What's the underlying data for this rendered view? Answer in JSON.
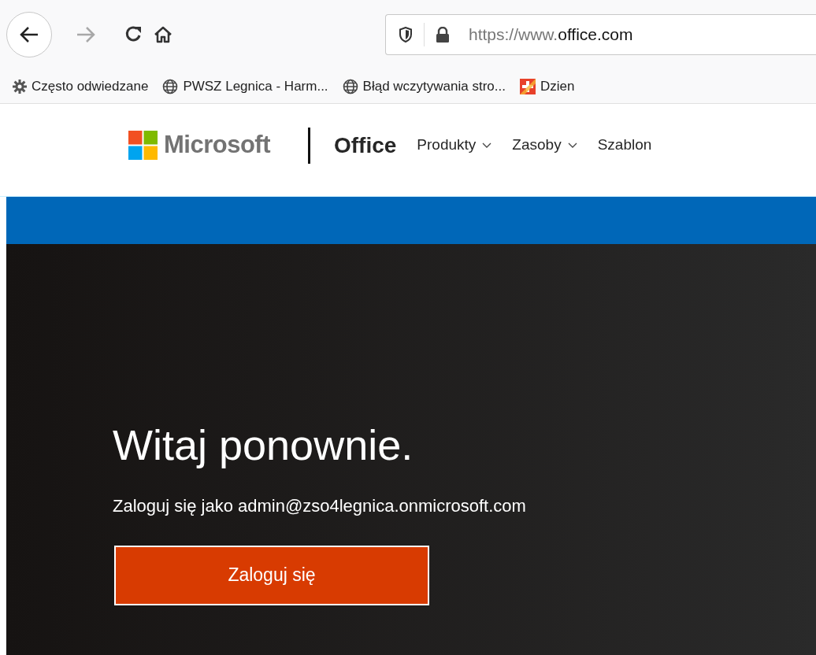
{
  "browser": {
    "url": "https://www.**office.com**"
  },
  "bookmarks": [
    {
      "kind": "folder",
      "label": "Często odwiedzane"
    },
    {
      "kind": "globe",
      "label": "PWSZ Legnica - Harm..."
    },
    {
      "kind": "globe",
      "label": "Błąd wczytywania stro..."
    },
    {
      "kind": "site",
      "label": "Dzien"
    }
  ],
  "header": {
    "brand": "Microsoft",
    "product": "Office",
    "nav": [
      {
        "label": "Produkty",
        "dropdown": true
      },
      {
        "label": "Zasoby",
        "dropdown": true
      },
      {
        "label": "Szablon",
        "dropdown": false
      }
    ]
  },
  "hero": {
    "title": "Witaj ponownie.",
    "subtitle": "Zaloguj się jako admin@zso4legnica.onmicrosoft.com",
    "button": "Zaloguj się"
  }
}
